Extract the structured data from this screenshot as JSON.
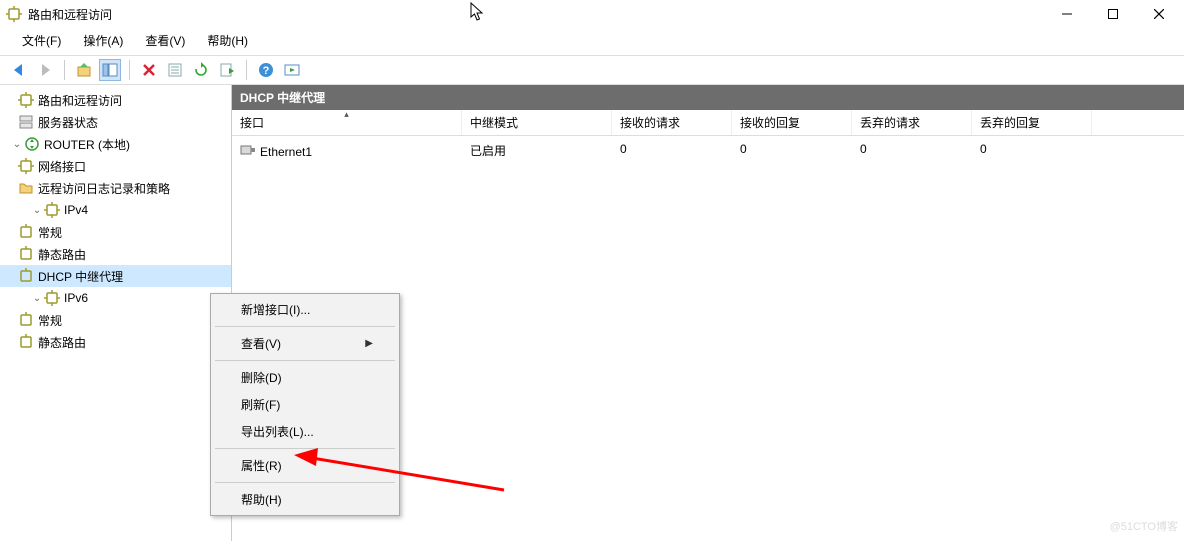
{
  "window": {
    "title": "路由和远程访问",
    "buttons": {
      "min": "minimize",
      "max": "maximize",
      "close": "close"
    }
  },
  "menubar": {
    "file": "文件(F)",
    "action": "操作(A)",
    "view": "查看(V)",
    "help": "帮助(H)"
  },
  "toolbar": {
    "back": "back",
    "forward": "forward",
    "up": "up",
    "show_hide": "show-hide",
    "delete": "delete",
    "properties": "properties",
    "refresh": "refresh",
    "export": "export",
    "help": "help",
    "run": "run"
  },
  "tree": {
    "root": "路由和远程访问",
    "server_status": "服务器状态",
    "router": "ROUTER (本地)",
    "net_if": "网络接口",
    "log": "远程访问日志记录和策略",
    "ipv4": "IPv4",
    "ipv4_general": "常规",
    "ipv4_static": "静态路由",
    "ipv4_dhcp_relay": "DHCP 中继代理",
    "ipv6": "IPv6",
    "ipv6_general": "常规",
    "ipv6_static": "静态路由"
  },
  "panel": {
    "title": "DHCP 中继代理"
  },
  "columns": {
    "interface": "接口",
    "relay_mode": "中继模式",
    "req_recv": "接收的请求",
    "resp_recv": "接收的回复",
    "req_discard": "丢弃的请求",
    "resp_discard": "丢弃的回复"
  },
  "rows": [
    {
      "interface": "Ethernet1",
      "relay_mode": "已启用",
      "req_recv": "0",
      "resp_recv": "0",
      "req_discard": "0",
      "resp_discard": "0"
    }
  ],
  "context_menu": {
    "new_if": "新增接口(I)...",
    "view": "查看(V)",
    "delete": "删除(D)",
    "refresh": "刷新(F)",
    "export": "导出列表(L)...",
    "properties": "属性(R)",
    "help": "帮助(H)"
  },
  "watermark": "@51CTO博客"
}
